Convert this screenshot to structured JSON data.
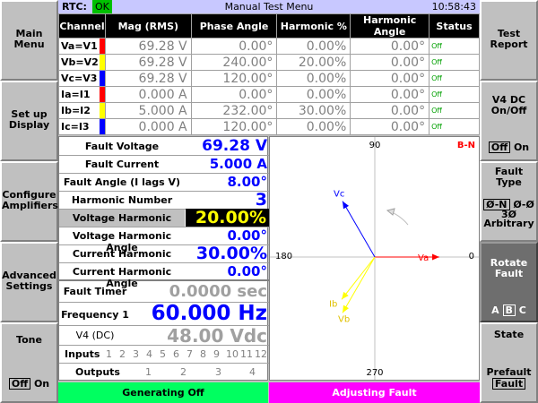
{
  "left_menu": [
    {
      "label": "Main\nMenu"
    },
    {
      "label": "Set up\nDisplay"
    },
    {
      "label": "Configure\nAmplifiers"
    },
    {
      "label": "Advanced\nSettings"
    },
    {
      "label": "Tone",
      "toggle_off": "Off",
      "toggle_on": "On"
    }
  ],
  "right_menu": {
    "test_report": "Test\nReport",
    "v4dc_title": "V4 DC\nOn/Off",
    "v4dc_off": "Off",
    "v4dc_on": "On",
    "fault_type_title": "Fault Type",
    "fault_type_selected": "Ø-N",
    "fault_type_phph": "Ø-Ø",
    "fault_type_3ph": "3Ø",
    "fault_type_arb": "Arbitrary",
    "rotate_fault": "Rotate\nFault",
    "rotate_a": "A",
    "rotate_b": "B",
    "rotate_c": "C",
    "state_title": "State",
    "state_prefault": "Prefault",
    "state_fault": "Fault"
  },
  "header": {
    "rtc_label": "RTC:",
    "rtc_status": "OK",
    "title": "Manual Test Menu",
    "time": "10:58:43"
  },
  "table": {
    "columns": [
      "Channel",
      "Mag (RMS)",
      "Phase Angle",
      "Harmonic %",
      "Harmonic Angle",
      "Status"
    ],
    "rows": [
      {
        "channel": "Va=V1",
        "mag": "69.28 V",
        "phase": "0.00°",
        "harm": "0.00%",
        "harm_angle": "0.00°",
        "status": "Off",
        "color": "#ff0000"
      },
      {
        "channel": "Vb=V2",
        "mag": "69.28 V",
        "phase": "240.00°",
        "harm": "20.00%",
        "harm_angle": "0.00°",
        "status": "Off",
        "color": "#ffff00"
      },
      {
        "channel": "Vc=V3",
        "mag": "69.28 V",
        "phase": "120.00°",
        "harm": "0.00%",
        "harm_angle": "0.00°",
        "status": "Off",
        "color": "#0000ff"
      },
      {
        "channel": "Ia=I1",
        "mag": "0.000 A",
        "phase": "0.00°",
        "harm": "0.00%",
        "harm_angle": "0.00°",
        "status": "Off",
        "color": "#ff0000"
      },
      {
        "channel": "Ib=I2",
        "mag": "5.000 A",
        "phase": "232.00°",
        "harm": "30.00%",
        "harm_angle": "0.00°",
        "status": "Off",
        "color": "#ffff00"
      },
      {
        "channel": "Ic=I3",
        "mag": "0.000 A",
        "phase": "120.00°",
        "harm": "0.00%",
        "harm_angle": "0.00°",
        "status": "Off",
        "color": "#0000ff"
      }
    ]
  },
  "fault": {
    "fault_voltage_label": "Fault Voltage",
    "fault_voltage": "69.28 V",
    "fault_current_label": "Fault Current",
    "fault_current": "5.000 A",
    "fault_angle_label": "Fault Angle (I lags V)",
    "fault_angle": "8.00°",
    "harmonic_number_label": "Harmonic Number",
    "harmonic_number": "3",
    "voltage_harmonic_label": "Voltage Harmonic",
    "voltage_harmonic": "20.00%",
    "voltage_harmonic_angle_label": "Voltage Harmonic Angle",
    "voltage_harmonic_angle": "0.00°",
    "current_harmonic_label": "Current Harmonic",
    "current_harmonic": "30.00%",
    "current_harmonic_angle_label": "Current Harmonic Angle",
    "current_harmonic_angle": "0.00°",
    "fault_timer_label": "Fault Timer",
    "fault_timer": "0.0000 sec",
    "frequency_label": "Frequency 1",
    "frequency": "60.000 Hz",
    "v4dc_label": "V4 (DC)",
    "v4dc": "48.00 Vdc",
    "inputs_label": "Inputs",
    "inputs": [
      "1",
      "2",
      "3",
      "4",
      "5",
      "6",
      "7",
      "8",
      "9",
      "10",
      "11",
      "12"
    ],
    "outputs_label": "Outputs",
    "outputs": [
      "1",
      "2",
      "3",
      "4"
    ]
  },
  "phasor": {
    "label_top": "90",
    "label_left": "180",
    "label_right": "0",
    "label_bottom": "270",
    "fault_label": "B-N",
    "vectors": [
      {
        "name": "Va",
        "angle_deg": 0,
        "magnitude": 69.28,
        "color": "#ff0000"
      },
      {
        "name": "Vb",
        "angle_deg": 240,
        "magnitude": 69.28,
        "color": "#ffff00"
      },
      {
        "name": "Vc",
        "angle_deg": 120,
        "magnitude": 69.28,
        "color": "#0000ff"
      },
      {
        "name": "Ib",
        "angle_deg": 232,
        "magnitude": 5.0,
        "color": "#ffff00"
      }
    ]
  },
  "status": {
    "generating": "Generating Off",
    "adjusting": "Adjusting Fault"
  },
  "colors": {
    "ok": "#00c000",
    "generating": "#00ff60",
    "adjusting": "#ff00ff",
    "value_blue": "#0000ff"
  }
}
